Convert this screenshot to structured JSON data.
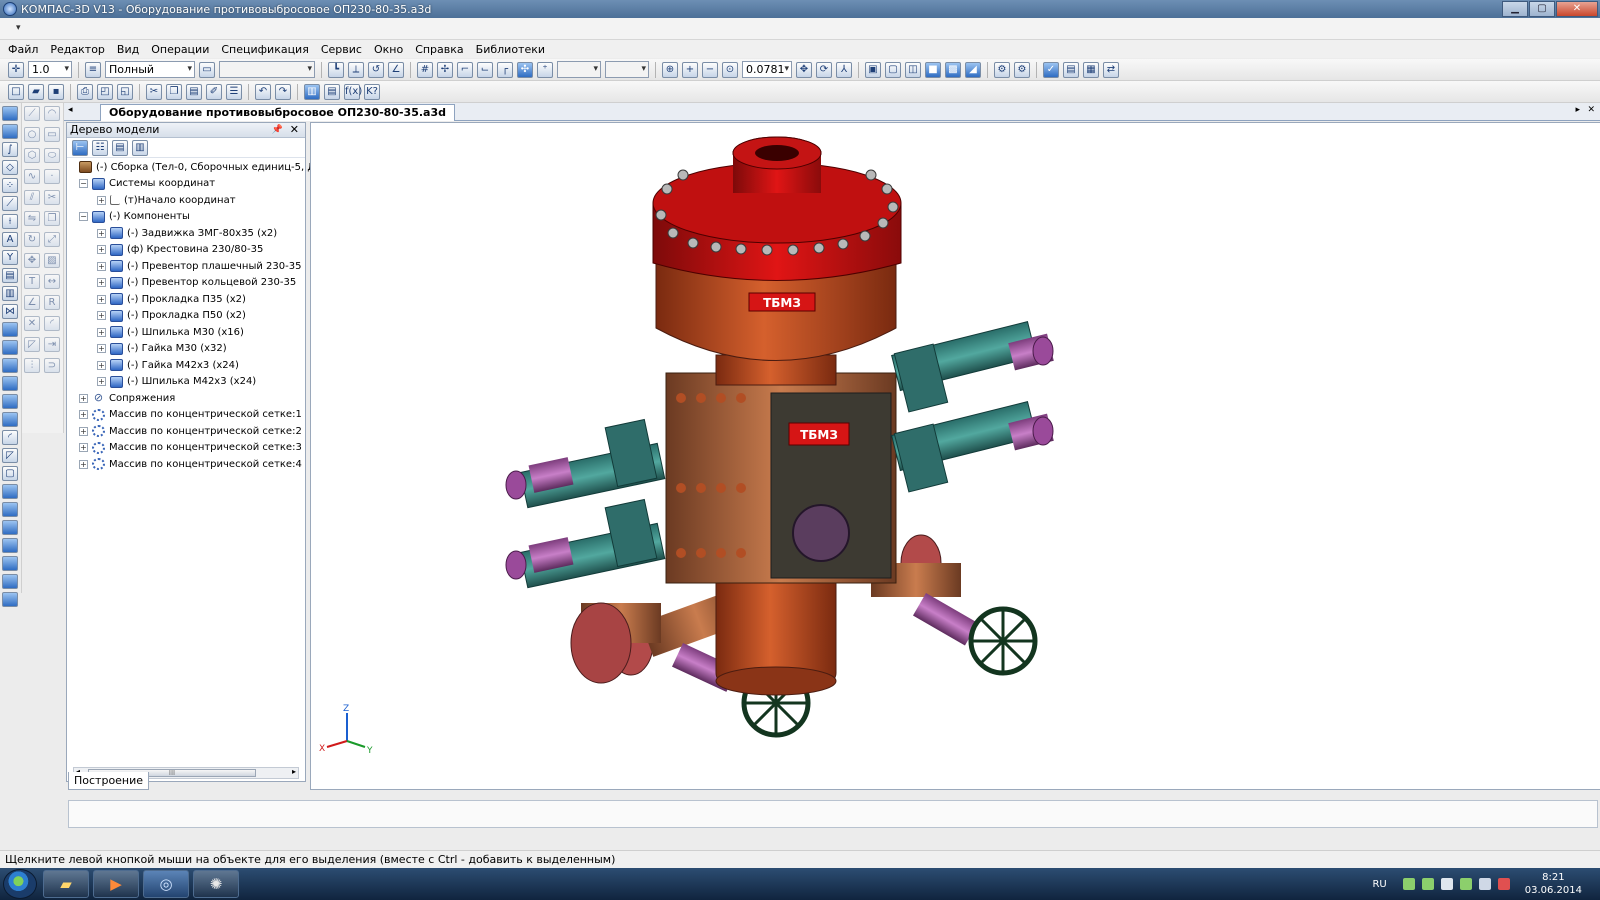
{
  "window": {
    "title": "КОМПАС-3D V13 - Оборудование противовыбросовое ОП230-80-35.a3d",
    "minimize": "▁",
    "maximize": "▢",
    "close": "✕"
  },
  "menu": [
    "Файл",
    "Редактор",
    "Вид",
    "Операции",
    "Спецификация",
    "Сервис",
    "Окно",
    "Справка",
    "Библиотеки"
  ],
  "toolbar": {
    "step_value": "1.0",
    "view_mode": "Полный",
    "zoom_value": "0.0781",
    "fx_label": "f(x)",
    "help_label": "K?"
  },
  "document_tab": {
    "title": "Оборудование противовыбросовое ОП230-80-35.a3d"
  },
  "model_tree": {
    "header": "Дерево модели",
    "items": [
      {
        "label": "(-) Сборка (Тел-0, Сборочных единиц-5, Дета"
      },
      {
        "label": "Системы координат"
      },
      {
        "label": "(т)Начало координат"
      },
      {
        "label": "(-) Компоненты"
      },
      {
        "label": "(-) Задвижка ЗМГ-80х35 (х2)"
      },
      {
        "label": "(ф) Крестовина 230/80-35"
      },
      {
        "label": "(-) Превентор плашечный 230-35"
      },
      {
        "label": "(-) Превентор кольцевой 230-35"
      },
      {
        "label": "(-) Прокладка П35  (х2)"
      },
      {
        "label": "(-) Прокладка П50 (х2)"
      },
      {
        "label": "(-) Шпилька М30 (х16)"
      },
      {
        "label": "(-) Гайка М30 (х32)"
      },
      {
        "label": "(-) Гайка М42х3 (х24)"
      },
      {
        "label": "(-) Шпилька М42х3 (х24)"
      },
      {
        "label": "Сопряжения"
      },
      {
        "label": "Массив по концентрической сетке:1"
      },
      {
        "label": "Массив по концентрической сетке:2"
      },
      {
        "label": "Массив по концентрической сетке:3"
      },
      {
        "label": "Массив по концентрической сетке:4"
      }
    ],
    "scroll_thumb": "III",
    "build_tab": "Построение"
  },
  "model": {
    "nameplate_top": "ТБМЗ",
    "nameplate_mid": "ТБМЗ"
  },
  "axes": {
    "x": "X",
    "y": "Y",
    "z": "Z"
  },
  "status_text": "Щелкните левой кнопкой мыши на объекте для его выделения (вместе с Ctrl - добавить к выделенным)",
  "tray": {
    "lang": "RU",
    "time": "8:21",
    "date": "03.06.2014"
  }
}
